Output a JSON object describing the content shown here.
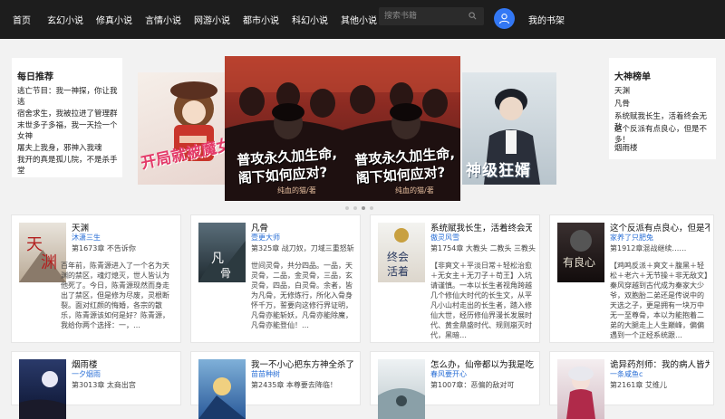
{
  "nav": {
    "items": [
      "首页",
      "玄幻小说",
      "修真小说",
      "言情小说",
      "网游小说",
      "都市小说",
      "科幻小说",
      "其他小说"
    ],
    "search_placeholder": "搜索书籍",
    "shelf": "我的书架"
  },
  "daily": {
    "title": "每日推荐",
    "items": [
      "逃亡节目：我一神探，你让我逃",
      "宿舍求生，我被拉进了管理群",
      "末世多子多福，我一天捡一个女神",
      "屠夫上我身，邪神入我魂",
      "我开的真是孤儿院，不是杀手堂"
    ]
  },
  "ranking": {
    "title": "大神榜单",
    "items": [
      "天渊",
      "凡骨",
      "系统赋我长生，活着终会无敌",
      "这个反派有点良心，但是不多！",
      "烟雨楼"
    ]
  },
  "banner": {
    "left_text": "开局就被魔女我",
    "center_text_line1": "普攻永久加生命,",
    "center_text_line2": "阁下如何应对?",
    "center_sub": "纯血的猫/著",
    "right_text": "神级狂婿"
  },
  "colors": {
    "nav_bg": "#1d1d1d",
    "avatar": "#3378f5",
    "author": "#2a6fd6"
  },
  "cards_row1": [
    {
      "title": "天渊",
      "author": "沐潇三生",
      "meta": "第1673章 不告诉你",
      "desc": "百年前，陈青源进入了一个名为天渊的禁区，魂灯熄灭，世人皆认为他死了。今日，陈青源现然而身走出了禁区，但是修为尽废，灵根断裂。面对红颜的悔婚，各宗的散乐，陈青源该如何是好？陈青源，我给你两个选择：一，…"
    },
    {
      "title": "凡骨",
      "author": "壹更大师",
      "meta": "第325章 战刀奴，刀域三重怒斩",
      "desc": "世间灵骨，共分四品。一品，天灵骨，二品，金灵骨，三品，玄灵骨，四品，白灵骨。余者，皆为凡骨，无修炼行，所化入骨身怀千万，誓要向这修行界证明，凡骨亦能斩妖，凡骨亦能除魔，凡骨亦能登仙！…"
    },
    {
      "title": "系统赋我长生，活着终会无敌",
      "author": "傲灵风雪",
      "meta": "第1754章 大教头 二教头 三教头",
      "desc": "【非爽文＋平淡日常＋轻松治愈＋无女主＋无刀子＋苟王】入坑请谨慎。一本以长生者视角跨越几个修仙大时代的长生文，从平凡小山村走出的长生者，踏入修仙大世，经历修仙界漫长发展时代、黄金鼎盛时代、规则崩灭时代，黑暗…"
    },
    {
      "title": "这个反派有点良心，但是不多！",
      "author": "家养了只肥兔",
      "meta": "第1912章混战继续……",
      "desc": "【鸡鸣反派＋爽文＋腹黑＋轻松＋老六＋无节操＋非无敌文】秦风穿越到古代成为秦家大少爷，双胞胎二弟还是传说中的天选之子，更是拥有一块万中无一至尊骨，本以为能抱着二弟的大腿走上人生巅峰，偏偏遇到一个正经系统跟…"
    }
  ],
  "cards_row2": [
    {
      "title": "烟雨楼",
      "author": "一夕烟雨",
      "meta": "第3013章 太商出宫"
    },
    {
      "title": "我一不小心把东方神全杀了",
      "author": "苗苗种树",
      "meta": "第2435章 本尊要去降临！"
    },
    {
      "title": "怎么办，仙帝都以为我是吃货",
      "author": "春风要开心",
      "meta": "第1007章：恶偏的敌对可"
    },
    {
      "title": "诡异药剂师：我的病人皆为恐怖",
      "author": "一条咸鱼c",
      "meta": "第2161章 艾维儿"
    }
  ]
}
